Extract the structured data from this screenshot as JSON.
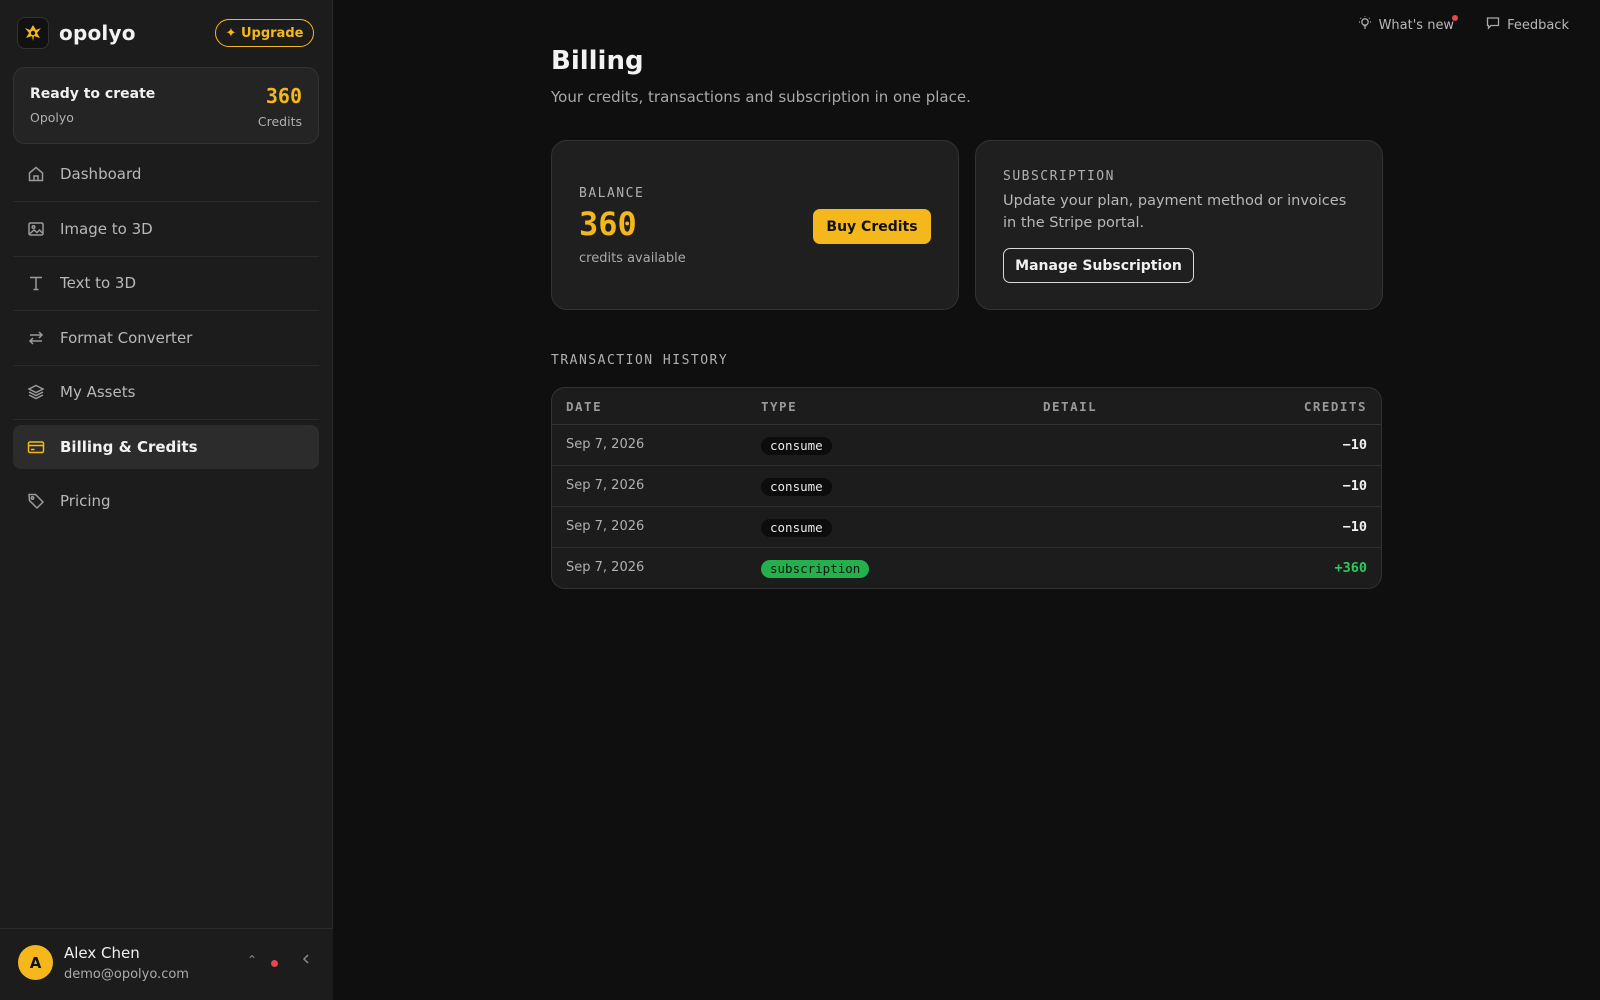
{
  "brand": {
    "name": "opolyo",
    "upgrade_label": "✦ Upgrade"
  },
  "credit_card": {
    "title": "Ready to create",
    "workspace": "Opolyo",
    "credits": "360",
    "credits_label": "Credits"
  },
  "nav": {
    "items": [
      {
        "label": "Dashboard",
        "icon": "home-icon"
      },
      {
        "label": "Image to 3D",
        "icon": "image-icon"
      },
      {
        "label": "Text to 3D",
        "icon": "text-icon"
      },
      {
        "label": "Format Converter",
        "icon": "swap-icon"
      },
      {
        "label": "My Assets",
        "icon": "layers-icon"
      },
      {
        "label": "Billing & Credits",
        "icon": "credit-card-icon",
        "active": true
      },
      {
        "label": "Pricing",
        "icon": "tag-icon"
      }
    ]
  },
  "user": {
    "initial": "A",
    "name": "Alex Chen",
    "email": "demo@opolyo.com"
  },
  "topbar": {
    "whats_new": "What's new",
    "feedback": "Feedback"
  },
  "page": {
    "title": "Billing",
    "subtitle": "Your credits, transactions and subscription in one place."
  },
  "balance": {
    "label": "BALANCE",
    "value": "360",
    "desc": "credits available",
    "buy_label": "Buy Credits"
  },
  "subscription": {
    "label": "SUBSCRIPTION",
    "desc": "Update your plan, payment method or invoices in the Stripe portal.",
    "manage_label": "Manage Subscription"
  },
  "transactions": {
    "label": "TRANSACTION HISTORY",
    "columns": {
      "date": "DATE",
      "type": "TYPE",
      "detail": "DETAIL",
      "credits": "CREDITS"
    },
    "rows": [
      {
        "date": "Sep 7, 2026",
        "type": "consume",
        "detail": "",
        "credits": "−10"
      },
      {
        "date": "Sep 7, 2026",
        "type": "consume",
        "detail": "",
        "credits": "−10"
      },
      {
        "date": "Sep 7, 2026",
        "type": "consume",
        "detail": "",
        "credits": "−10"
      },
      {
        "date": "Sep 7, 2026",
        "type": "subscription",
        "detail": "",
        "credits": "+360"
      }
    ]
  },
  "colors": {
    "accent": "#f5b81c",
    "positive": "#2ec95c",
    "alert": "#e54848"
  }
}
